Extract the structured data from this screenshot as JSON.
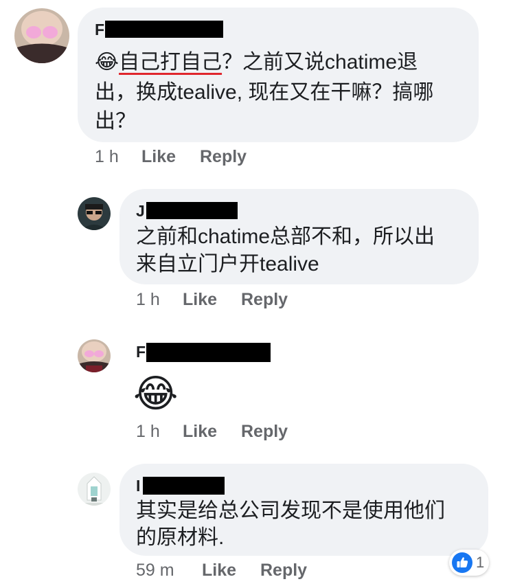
{
  "comments": [
    {
      "author_initial": "F",
      "prefix_emoji": "😂",
      "underlined_text": "自己打自己",
      "line1_rest": "？之前又说chatime退",
      "line2": "出，换成tealive, 现在又在干嘛？搞哪",
      "line3": "出？",
      "time": "1 h",
      "like_label": "Like",
      "reply_label": "Reply"
    },
    {
      "author_initial": "J",
      "line1": "之前和chatime总部不和，所以出",
      "line2": "来自立门户开tealive",
      "time": "1 h",
      "like_label": "Like",
      "reply_label": "Reply"
    },
    {
      "author_initial": "F",
      "emoji": "😂",
      "time": "1 h",
      "like_label": "Like",
      "reply_label": "Reply"
    },
    {
      "author_initial": "I",
      "line1": "其实是给总公司发现不是使用他们",
      "line2": "的原材料.",
      "time": "59 m",
      "like_label": "Like",
      "reply_label": "Reply",
      "reaction_count": "1"
    }
  ],
  "colors": {
    "bubble": "#f0f2f5",
    "meta": "#65676b",
    "like_blue": "#1877f2",
    "underline_red": "#e0262c"
  }
}
